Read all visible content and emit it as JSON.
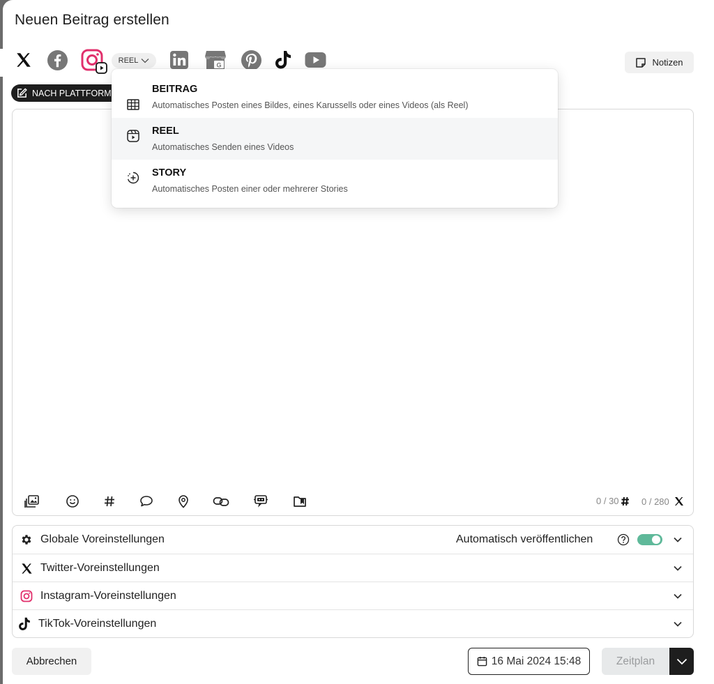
{
  "dialog": {
    "title": "Neuen Beitrag erstellen"
  },
  "platforms": {
    "items": [
      "x-icon",
      "facebook-icon",
      "instagram-icon",
      "linkedin-icon",
      "google-business-icon",
      "pinterest-icon",
      "tiktok-icon",
      "youtube-icon"
    ],
    "selected_format": "REEL",
    "instagram_color": "#e1306c"
  },
  "notes_button": {
    "label": "Notizen"
  },
  "mode_button": {
    "label": "NACH PLATTFORM"
  },
  "format_menu": {
    "items": [
      {
        "title": "BEITRAG",
        "description": "Automatisches Posten eines Bildes, eines Karussells oder eines Videos (als Reel)"
      },
      {
        "title": "REEL",
        "description": "Automatisches Senden eines Videos"
      },
      {
        "title": "STORY",
        "description": "Automatisches Posten einer oder mehrerer Stories"
      }
    ],
    "selected_index": 1
  },
  "editor": {
    "hashtag_counter": "0 / 30",
    "char_counter": "0 / 280"
  },
  "settings": {
    "global_label": "Globale Voreinstellungen",
    "auto_publish_label": "Automatisch veröffentlichen",
    "auto_publish_on": true,
    "twitter_label": "Twitter-Voreinstellungen",
    "instagram_label": "Instagram-Voreinstellungen",
    "tiktok_label": "TikTok-Voreinstellungen",
    "toggle_color": "#5fb99a"
  },
  "footer": {
    "cancel_label": "Abbrechen",
    "date_label": "16 Mai 2024 15:48",
    "schedule_label": "Zeitplan"
  }
}
